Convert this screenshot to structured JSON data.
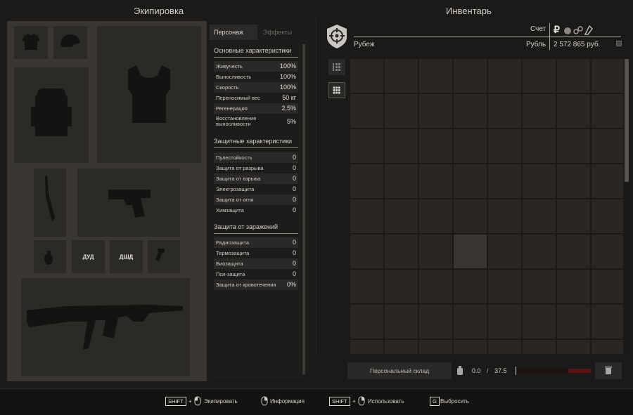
{
  "panels": {
    "equipment_title": "Экипировка",
    "inventory_title": "Инвентарь"
  },
  "equipment": {
    "slots": [
      {
        "name": "shirt-slot",
        "icon": "shirt-icon",
        "label": ""
      },
      {
        "name": "helmet-slot",
        "icon": "helmet-icon",
        "label": ""
      },
      {
        "name": "armor-slot",
        "icon": "vest-icon",
        "label": ""
      },
      {
        "name": "backpack-slot",
        "icon": "backpack-icon",
        "label": ""
      },
      {
        "name": "knife-slot",
        "icon": "knife-icon",
        "label": ""
      },
      {
        "name": "pistol-slot",
        "icon": "pistol-icon",
        "label": ""
      },
      {
        "name": "grenade-slot",
        "icon": "grenade-icon",
        "label": ""
      },
      {
        "name": "dud-slot",
        "icon": "",
        "label": "ДУД"
      },
      {
        "name": "dshd-slot",
        "icon": "",
        "label": "ДШД"
      },
      {
        "name": "tool-slot",
        "icon": "tool-icon",
        "label": ""
      },
      {
        "name": "rifle-slot",
        "icon": "rifle-icon",
        "label": ""
      }
    ]
  },
  "stats": {
    "tabs": {
      "character": "Персонаж",
      "effects": "Эффекты"
    },
    "basic_title": "Основные характеристики",
    "basic": [
      {
        "label": "Живучесть",
        "value": "100%"
      },
      {
        "label": "Выносливость",
        "value": "100%"
      },
      {
        "label": "Скорость",
        "value": "100%"
      },
      {
        "label": "Переносимый вес",
        "value": "50 кг"
      },
      {
        "label": "Регенерация",
        "value": "2,5%"
      },
      {
        "label": "Восстановление выносливости",
        "value": "5%"
      }
    ],
    "protection_title": "Защитные характеристики",
    "protection": [
      {
        "label": "Пулестойкость",
        "value": "0"
      },
      {
        "label": "Защита от разрыва",
        "value": "0"
      },
      {
        "label": "Защита от взрыва",
        "value": "0"
      },
      {
        "label": "Электрозащита",
        "value": "0"
      },
      {
        "label": "Защита от огня",
        "value": "0"
      },
      {
        "label": "Химзащита",
        "value": "0"
      }
    ],
    "infection_title": "Защита от заражений",
    "infection": [
      {
        "label": "Радиозащита",
        "value": "0"
      },
      {
        "label": "Термозащита",
        "value": "0"
      },
      {
        "label": "Биозащита",
        "value": "0"
      },
      {
        "label": "Пси-защита",
        "value": "0"
      },
      {
        "label": "Защита от кровотечения",
        "value": "0%"
      }
    ]
  },
  "inventory": {
    "faction": "Рубеж",
    "account_label": "Счет",
    "currency_label": "Рубль",
    "balance": "2 572 865 руб.",
    "currency_icons": [
      "ruble-icon",
      "coin-icon",
      "chain-icon",
      "token-icon"
    ],
    "grid": {
      "cols": 8,
      "rows": 9,
      "highlight": [
        [
          5,
          3
        ]
      ]
    },
    "storage_button": "Персональный склад",
    "weight_current": "0.0",
    "weight_sep": "/",
    "weight_max": "37.5",
    "weight_fraction": 0.0,
    "weight_bar_color": "#5c1415"
  },
  "footer": {
    "actions": [
      {
        "key": "SHIFT",
        "plus": "+",
        "mouse": "left",
        "label": "Экипировать"
      },
      {
        "key": "",
        "plus": "",
        "mouse": "right",
        "label": "Информация"
      },
      {
        "key": "SHIFT",
        "plus": "+",
        "mouse": "right",
        "label": "Использовать"
      },
      {
        "key": "G",
        "plus": "",
        "mouse": "",
        "label": "Выбросить"
      }
    ]
  },
  "colors": {
    "accent": "#a91f22",
    "panel": "#3a3632",
    "slot": "#2c2a27",
    "cell": "#2a2623"
  }
}
